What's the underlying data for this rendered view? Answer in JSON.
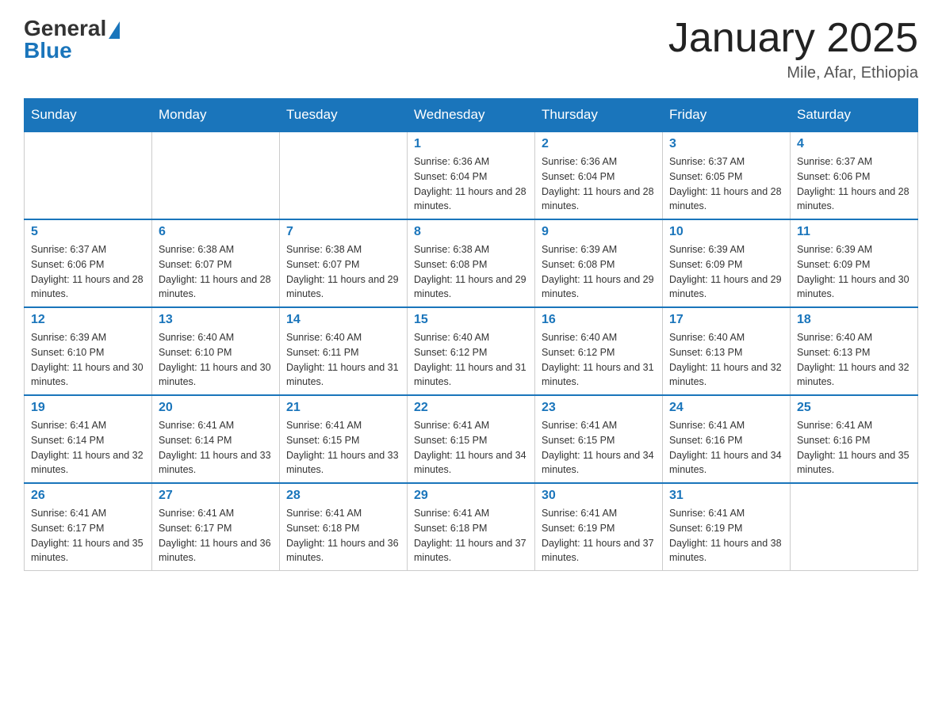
{
  "header": {
    "logo_general": "General",
    "logo_blue": "Blue",
    "title": "January 2025",
    "subtitle": "Mile, Afar, Ethiopia"
  },
  "weekdays": [
    "Sunday",
    "Monday",
    "Tuesday",
    "Wednesday",
    "Thursday",
    "Friday",
    "Saturday"
  ],
  "weeks": [
    [
      {
        "day": "",
        "info": ""
      },
      {
        "day": "",
        "info": ""
      },
      {
        "day": "",
        "info": ""
      },
      {
        "day": "1",
        "info": "Sunrise: 6:36 AM\nSunset: 6:04 PM\nDaylight: 11 hours and 28 minutes."
      },
      {
        "day": "2",
        "info": "Sunrise: 6:36 AM\nSunset: 6:04 PM\nDaylight: 11 hours and 28 minutes."
      },
      {
        "day": "3",
        "info": "Sunrise: 6:37 AM\nSunset: 6:05 PM\nDaylight: 11 hours and 28 minutes."
      },
      {
        "day": "4",
        "info": "Sunrise: 6:37 AM\nSunset: 6:06 PM\nDaylight: 11 hours and 28 minutes."
      }
    ],
    [
      {
        "day": "5",
        "info": "Sunrise: 6:37 AM\nSunset: 6:06 PM\nDaylight: 11 hours and 28 minutes."
      },
      {
        "day": "6",
        "info": "Sunrise: 6:38 AM\nSunset: 6:07 PM\nDaylight: 11 hours and 28 minutes."
      },
      {
        "day": "7",
        "info": "Sunrise: 6:38 AM\nSunset: 6:07 PM\nDaylight: 11 hours and 29 minutes."
      },
      {
        "day": "8",
        "info": "Sunrise: 6:38 AM\nSunset: 6:08 PM\nDaylight: 11 hours and 29 minutes."
      },
      {
        "day": "9",
        "info": "Sunrise: 6:39 AM\nSunset: 6:08 PM\nDaylight: 11 hours and 29 minutes."
      },
      {
        "day": "10",
        "info": "Sunrise: 6:39 AM\nSunset: 6:09 PM\nDaylight: 11 hours and 29 minutes."
      },
      {
        "day": "11",
        "info": "Sunrise: 6:39 AM\nSunset: 6:09 PM\nDaylight: 11 hours and 30 minutes."
      }
    ],
    [
      {
        "day": "12",
        "info": "Sunrise: 6:39 AM\nSunset: 6:10 PM\nDaylight: 11 hours and 30 minutes."
      },
      {
        "day": "13",
        "info": "Sunrise: 6:40 AM\nSunset: 6:10 PM\nDaylight: 11 hours and 30 minutes."
      },
      {
        "day": "14",
        "info": "Sunrise: 6:40 AM\nSunset: 6:11 PM\nDaylight: 11 hours and 31 minutes."
      },
      {
        "day": "15",
        "info": "Sunrise: 6:40 AM\nSunset: 6:12 PM\nDaylight: 11 hours and 31 minutes."
      },
      {
        "day": "16",
        "info": "Sunrise: 6:40 AM\nSunset: 6:12 PM\nDaylight: 11 hours and 31 minutes."
      },
      {
        "day": "17",
        "info": "Sunrise: 6:40 AM\nSunset: 6:13 PM\nDaylight: 11 hours and 32 minutes."
      },
      {
        "day": "18",
        "info": "Sunrise: 6:40 AM\nSunset: 6:13 PM\nDaylight: 11 hours and 32 minutes."
      }
    ],
    [
      {
        "day": "19",
        "info": "Sunrise: 6:41 AM\nSunset: 6:14 PM\nDaylight: 11 hours and 32 minutes."
      },
      {
        "day": "20",
        "info": "Sunrise: 6:41 AM\nSunset: 6:14 PM\nDaylight: 11 hours and 33 minutes."
      },
      {
        "day": "21",
        "info": "Sunrise: 6:41 AM\nSunset: 6:15 PM\nDaylight: 11 hours and 33 minutes."
      },
      {
        "day": "22",
        "info": "Sunrise: 6:41 AM\nSunset: 6:15 PM\nDaylight: 11 hours and 34 minutes."
      },
      {
        "day": "23",
        "info": "Sunrise: 6:41 AM\nSunset: 6:15 PM\nDaylight: 11 hours and 34 minutes."
      },
      {
        "day": "24",
        "info": "Sunrise: 6:41 AM\nSunset: 6:16 PM\nDaylight: 11 hours and 34 minutes."
      },
      {
        "day": "25",
        "info": "Sunrise: 6:41 AM\nSunset: 6:16 PM\nDaylight: 11 hours and 35 minutes."
      }
    ],
    [
      {
        "day": "26",
        "info": "Sunrise: 6:41 AM\nSunset: 6:17 PM\nDaylight: 11 hours and 35 minutes."
      },
      {
        "day": "27",
        "info": "Sunrise: 6:41 AM\nSunset: 6:17 PM\nDaylight: 11 hours and 36 minutes."
      },
      {
        "day": "28",
        "info": "Sunrise: 6:41 AM\nSunset: 6:18 PM\nDaylight: 11 hours and 36 minutes."
      },
      {
        "day": "29",
        "info": "Sunrise: 6:41 AM\nSunset: 6:18 PM\nDaylight: 11 hours and 37 minutes."
      },
      {
        "day": "30",
        "info": "Sunrise: 6:41 AM\nSunset: 6:19 PM\nDaylight: 11 hours and 37 minutes."
      },
      {
        "day": "31",
        "info": "Sunrise: 6:41 AM\nSunset: 6:19 PM\nDaylight: 11 hours and 38 minutes."
      },
      {
        "day": "",
        "info": ""
      }
    ]
  ]
}
